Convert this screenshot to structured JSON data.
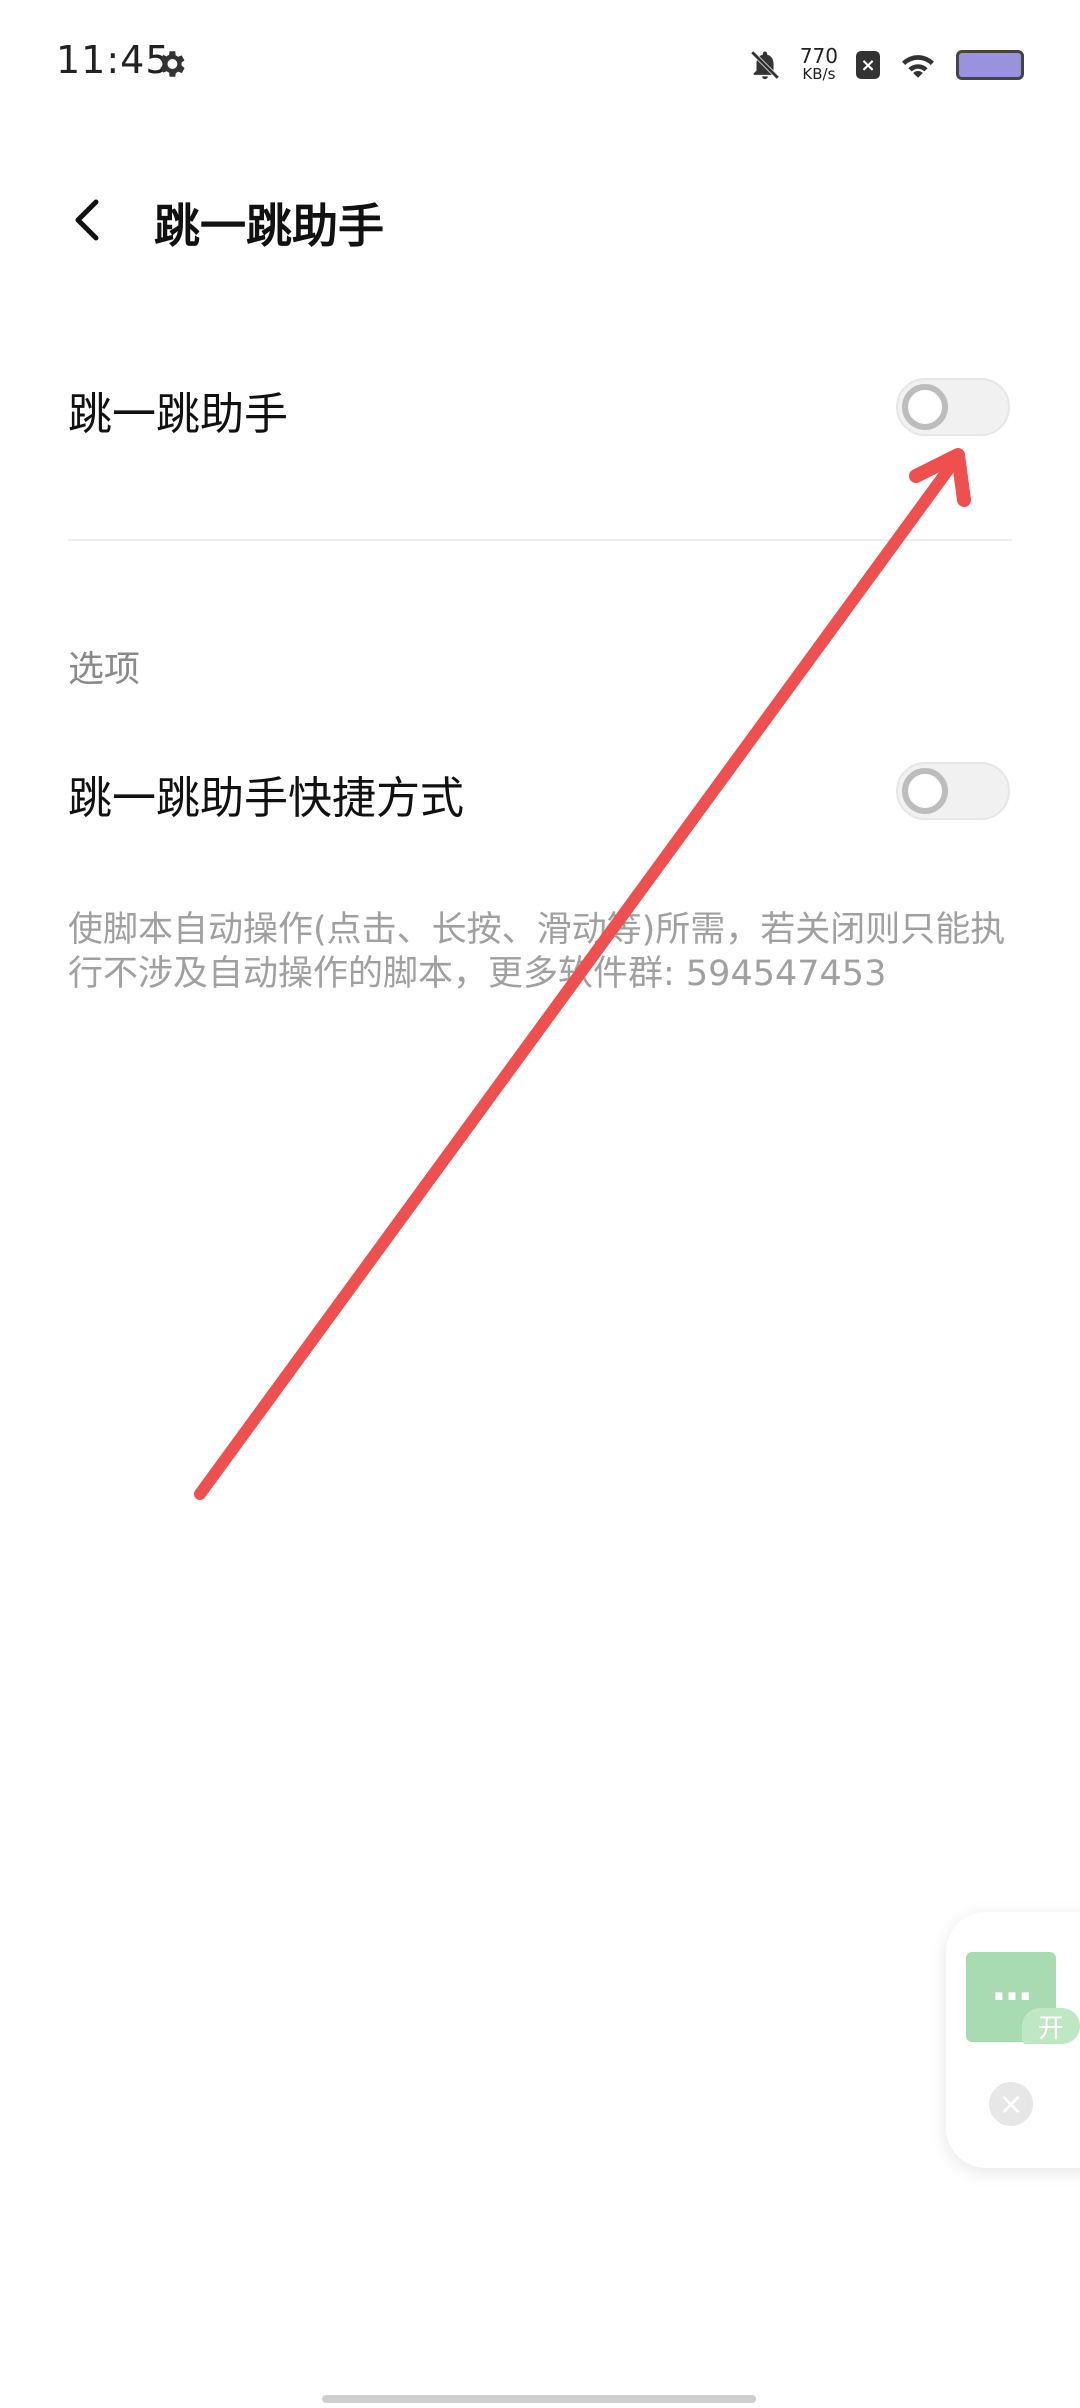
{
  "status_bar": {
    "time": "11:45",
    "net_speed_value": "770",
    "net_speed_unit": "KB/s",
    "icons": [
      "gear-icon",
      "bell-off-icon",
      "sim-x-icon",
      "wifi-icon",
      "battery-icon"
    ]
  },
  "header": {
    "back_icon": "chevron-left-icon",
    "title": "跳一跳助手"
  },
  "settings": {
    "main_toggle_label": "跳一跳助手",
    "main_toggle_on": false,
    "section_title": "选项",
    "shortcut_toggle_label": "跳一跳助手快捷方式",
    "shortcut_toggle_on": false,
    "description": "使脚本自动操作(点击、长按、滑动等)所需，若关闭则只能执行不涉及自动操作的脚本，更多软件群: 594547453"
  },
  "annotation": {
    "arrow_color": "#ee4f4f"
  },
  "floating_panel": {
    "button_icon": "more-dots-icon",
    "tag": "开",
    "close_icon": "close-icon"
  },
  "colors": {
    "background": "#ffffff",
    "text_primary": "#111111",
    "text_secondary": "#8a8a8a",
    "float_button": "#a8dbb2"
  }
}
